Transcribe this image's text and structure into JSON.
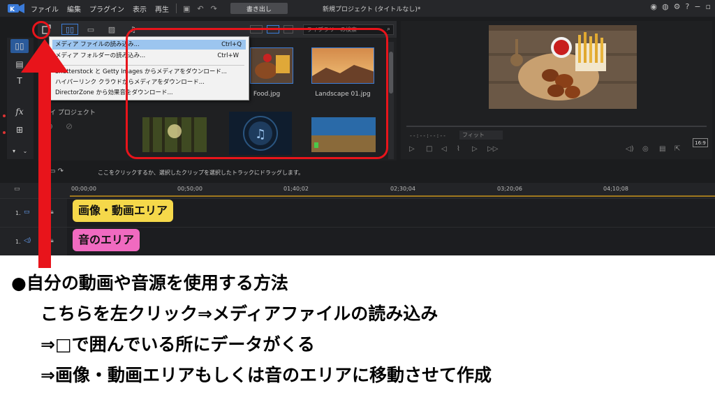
{
  "menu": {
    "items": [
      "ファイル",
      "編集",
      "プラグイン",
      "表示",
      "再生"
    ],
    "export_label": "書き出し",
    "window_title": "新規プロジェクト (タイトルなし)*",
    "controls": [
      "?",
      "−",
      "▫"
    ]
  },
  "media": {
    "search_placeholder": "ライブラリーの検索",
    "project_label": "マイ プロジェクト",
    "captions": [
      "Food.jpg",
      "Landscape 01.jpg"
    ]
  },
  "dropdown": {
    "items": [
      {
        "label": "メディア ファイルの読み込み...",
        "shortcut": "Ctrl+Q"
      },
      {
        "label": "メディア フォルダーの読み込み...",
        "shortcut": "Ctrl+W"
      },
      {
        "label": "Shutterstock と Getty Images からメディアをダウンロード...",
        "shortcut": ""
      },
      {
        "label": "ハイパーリンク クラウドからメディアをダウンロード...",
        "shortcut": ""
      },
      {
        "label": "DirectorZone から効果音をダウンロード...",
        "shortcut": ""
      }
    ]
  },
  "preview": {
    "timecode": "--:--:--:--",
    "fit_label": "フィット",
    "ratio_label": "16:9"
  },
  "timeline": {
    "hint": "ここをクリックするか、選択したクリップを選択したトラックにドラッグします。",
    "ticks": [
      "00;00;00",
      "00;50;00",
      "01;40;02",
      "02;30;04",
      "03;20;06",
      "04;10;08"
    ],
    "track1_num": "1.",
    "track2_num": "1."
  },
  "labels": {
    "video_area": "画像・動画エリア",
    "audio_area": "音のエリア"
  },
  "caption": {
    "line1": "●自分の動画や音源を使用する方法",
    "line2": "こちらを左クリック⇒メディアファイルの読み込み",
    "line3": "⇒□で囲んでいる所にデータがくる",
    "line4": "⇒画像・動画エリアもしくは音のエリアに移動させて作成"
  },
  "colors": {
    "annotation_red": "#e8141b",
    "label_yellow": "#f5d84a",
    "label_pink": "#f06ac0",
    "accent_blue": "#3d7ed8"
  }
}
